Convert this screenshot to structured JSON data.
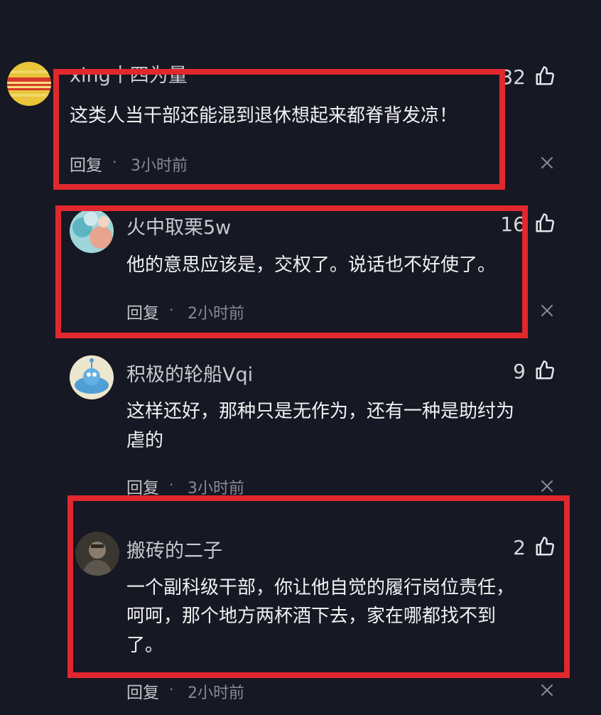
{
  "comments": [
    {
      "username": "xing十四为量",
      "like_count": "32",
      "content": "这类人当干部还能混到退休想起来都脊背发凉！",
      "reply_label": "回复",
      "dot": "·",
      "time": "3小时前"
    },
    {
      "username": "火中取栗5w",
      "like_count": "16",
      "content": "他的意思应该是，交权了。说话也不好使了。",
      "reply_label": "回复",
      "dot": "·",
      "time": "2小时前"
    },
    {
      "username": "积极的轮船Vqi",
      "like_count": "9",
      "content_line1": "这样还好，那种只是无作为，还有一种是助纣为",
      "content_line2": "虐的",
      "reply_label": "回复",
      "dot": "·",
      "time": "3小时前"
    },
    {
      "username": "搬砖的二子",
      "like_count": "2",
      "content_line1": "一个副科级干部，你让他自觉的履行岗位责任，",
      "content_line2": "呵呵，那个地方两杯酒下去，家在哪都找不到",
      "content_line3": "了。",
      "reply_label": "回复",
      "dot": "·",
      "time": "2小时前"
    }
  ],
  "icons": {
    "like": "thumbs-up-icon",
    "close": "close-icon"
  },
  "colors": {
    "background": "#161823",
    "highlight": "#e0282e"
  }
}
